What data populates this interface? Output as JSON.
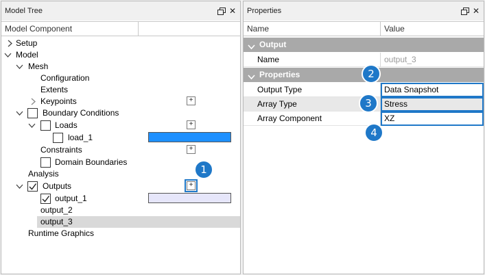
{
  "model_tree": {
    "title": "Model Tree",
    "column_header": "Model Component",
    "items": [
      {
        "label": "Setup"
      },
      {
        "label": "Model"
      },
      {
        "label": "Mesh"
      },
      {
        "label": "Configuration"
      },
      {
        "label": "Extents"
      },
      {
        "label": "Keypoints"
      },
      {
        "label": "Boundary Conditions"
      },
      {
        "label": "Loads"
      },
      {
        "label": "load_1"
      },
      {
        "label": "Constraints"
      },
      {
        "label": "Domain Boundaries"
      },
      {
        "label": "Analysis"
      },
      {
        "label": "Outputs"
      },
      {
        "label": "output_1"
      },
      {
        "label": "output_2"
      },
      {
        "label": "output_3"
      },
      {
        "label": "Runtime Graphics"
      }
    ],
    "add_button_label": "+",
    "colors": {
      "load_1_swatch": "#1e90ff",
      "output_1_swatch": "#e6e6fa",
      "selection": "#d9d9d9"
    }
  },
  "properties": {
    "title": "Properties",
    "col_name": "Name",
    "col_value": "Value",
    "groups": [
      {
        "label": "Output",
        "rows": [
          {
            "name": "Name",
            "value": "output_3"
          }
        ]
      },
      {
        "label": "Properties",
        "rows": [
          {
            "name": "Output Type",
            "value": "Data Snapshot"
          },
          {
            "name": "Array Type",
            "value": "Stress"
          },
          {
            "name": "Array Component",
            "value": "XZ"
          }
        ]
      }
    ]
  },
  "callouts": [
    "1",
    "2",
    "3",
    "4"
  ],
  "accent_color": "#1f78c8"
}
